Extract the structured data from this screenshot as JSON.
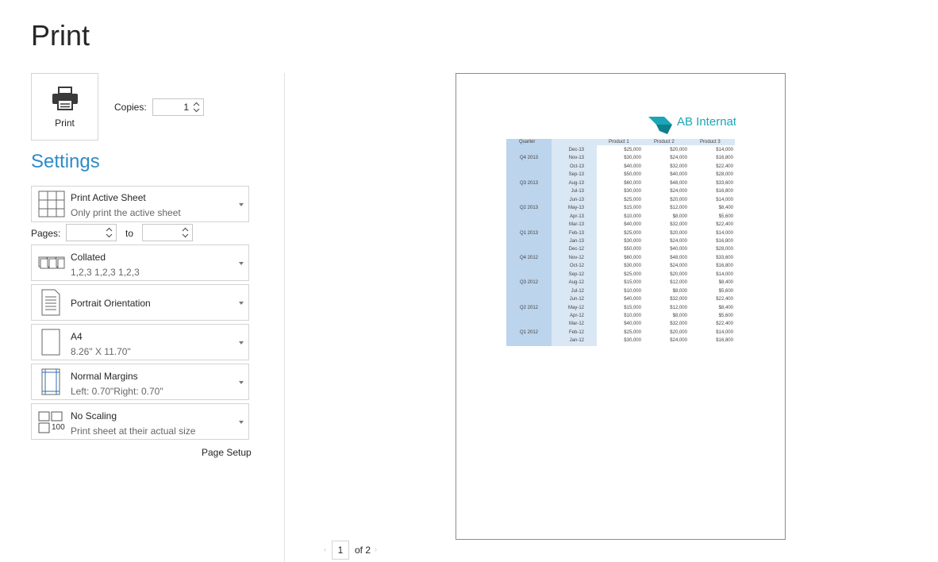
{
  "page": {
    "title": "Print"
  },
  "print_button": {
    "label": "Print"
  },
  "copies": {
    "label": "Copies:",
    "value": "1"
  },
  "settings": {
    "heading": "Settings"
  },
  "print_what": {
    "title": "Print Active Sheet",
    "subtitle": "Only print the active sheet"
  },
  "pages": {
    "label": "Pages:",
    "from_value": "",
    "to_label": "to",
    "to_value": ""
  },
  "collation": {
    "title": "Collated",
    "subtitle": "1,2,3   1,2,3   1,2,3"
  },
  "orientation": {
    "title": "Portrait Orientation"
  },
  "paper_size": {
    "title": "A4",
    "subtitle": "8.26\" X 11.70\""
  },
  "margins": {
    "title": "Normal Margins",
    "subtitle": "Left: 0.70\"Right: 0.70\""
  },
  "scaling": {
    "title": "No Scaling",
    "subtitle": "Print sheet at their actual size",
    "icon_text": "100"
  },
  "page_setup": {
    "label": "Page Setup"
  },
  "preview": {
    "logo_text": "AB Internati",
    "accent_color": "#1aa6b7",
    "headers": [
      "Quarter",
      "Product 1",
      "Product 2",
      "Product 3"
    ],
    "rows": [
      {
        "quarter": "",
        "month": "Dec-13",
        "p1": "$25,000",
        "p2": "$20,000",
        "p3": "$14,000"
      },
      {
        "quarter": "Q4 2013",
        "month": "Nov-13",
        "p1": "$30,000",
        "p2": "$24,000",
        "p3": "$16,800"
      },
      {
        "quarter": "",
        "month": "Oct-13",
        "p1": "$40,000",
        "p2": "$32,000",
        "p3": "$22,400"
      },
      {
        "quarter": "",
        "month": "Sep-13",
        "p1": "$50,000",
        "p2": "$40,000",
        "p3": "$28,000"
      },
      {
        "quarter": "Q3 2013",
        "month": "Aug-13",
        "p1": "$60,000",
        "p2": "$48,000",
        "p3": "$33,600"
      },
      {
        "quarter": "",
        "month": "Jul-13",
        "p1": "$30,000",
        "p2": "$24,000",
        "p3": "$16,800"
      },
      {
        "quarter": "",
        "month": "Jun-13",
        "p1": "$25,000",
        "p2": "$20,000",
        "p3": "$14,000"
      },
      {
        "quarter": "Q2 2013",
        "month": "May-13",
        "p1": "$15,000",
        "p2": "$12,000",
        "p3": "$8,400"
      },
      {
        "quarter": "",
        "month": "Apr-13",
        "p1": "$10,000",
        "p2": "$8,000",
        "p3": "$5,600"
      },
      {
        "quarter": "",
        "month": "Mar-13",
        "p1": "$40,000",
        "p2": "$32,000",
        "p3": "$22,400"
      },
      {
        "quarter": "Q1 2013",
        "month": "Feb-13",
        "p1": "$25,000",
        "p2": "$20,000",
        "p3": "$14,000"
      },
      {
        "quarter": "",
        "month": "Jan-13",
        "p1": "$30,000",
        "p2": "$24,000",
        "p3": "$16,800"
      },
      {
        "quarter": "",
        "month": "Dec-12",
        "p1": "$50,000",
        "p2": "$40,000",
        "p3": "$28,000"
      },
      {
        "quarter": "Q4 2012",
        "month": "Nov-12",
        "p1": "$60,000",
        "p2": "$48,000",
        "p3": "$33,600"
      },
      {
        "quarter": "",
        "month": "Oct-12",
        "p1": "$30,000",
        "p2": "$24,000",
        "p3": "$16,800"
      },
      {
        "quarter": "",
        "month": "Sep-12",
        "p1": "$25,000",
        "p2": "$20,000",
        "p3": "$14,000"
      },
      {
        "quarter": "Q3 2012",
        "month": "Aug-12",
        "p1": "$15,000",
        "p2": "$12,000",
        "p3": "$8,400"
      },
      {
        "quarter": "",
        "month": "Jul-12",
        "p1": "$10,000",
        "p2": "$8,000",
        "p3": "$5,600"
      },
      {
        "quarter": "",
        "month": "Jun-12",
        "p1": "$40,000",
        "p2": "$32,000",
        "p3": "$22,400"
      },
      {
        "quarter": "Q2 2012",
        "month": "May-12",
        "p1": "$15,000",
        "p2": "$12,000",
        "p3": "$8,400"
      },
      {
        "quarter": "",
        "month": "Apr-12",
        "p1": "$10,000",
        "p2": "$8,000",
        "p3": "$5,600"
      },
      {
        "quarter": "",
        "month": "Mar-12",
        "p1": "$40,000",
        "p2": "$32,000",
        "p3": "$22,400"
      },
      {
        "quarter": "Q1 2012",
        "month": "Feb-12",
        "p1": "$25,000",
        "p2": "$20,000",
        "p3": "$14,000"
      },
      {
        "quarter": "",
        "month": "Jan-12",
        "p1": "$30,000",
        "p2": "$24,000",
        "p3": "$16,800"
      }
    ]
  },
  "pager": {
    "current": "1",
    "of_text": "of 2"
  }
}
